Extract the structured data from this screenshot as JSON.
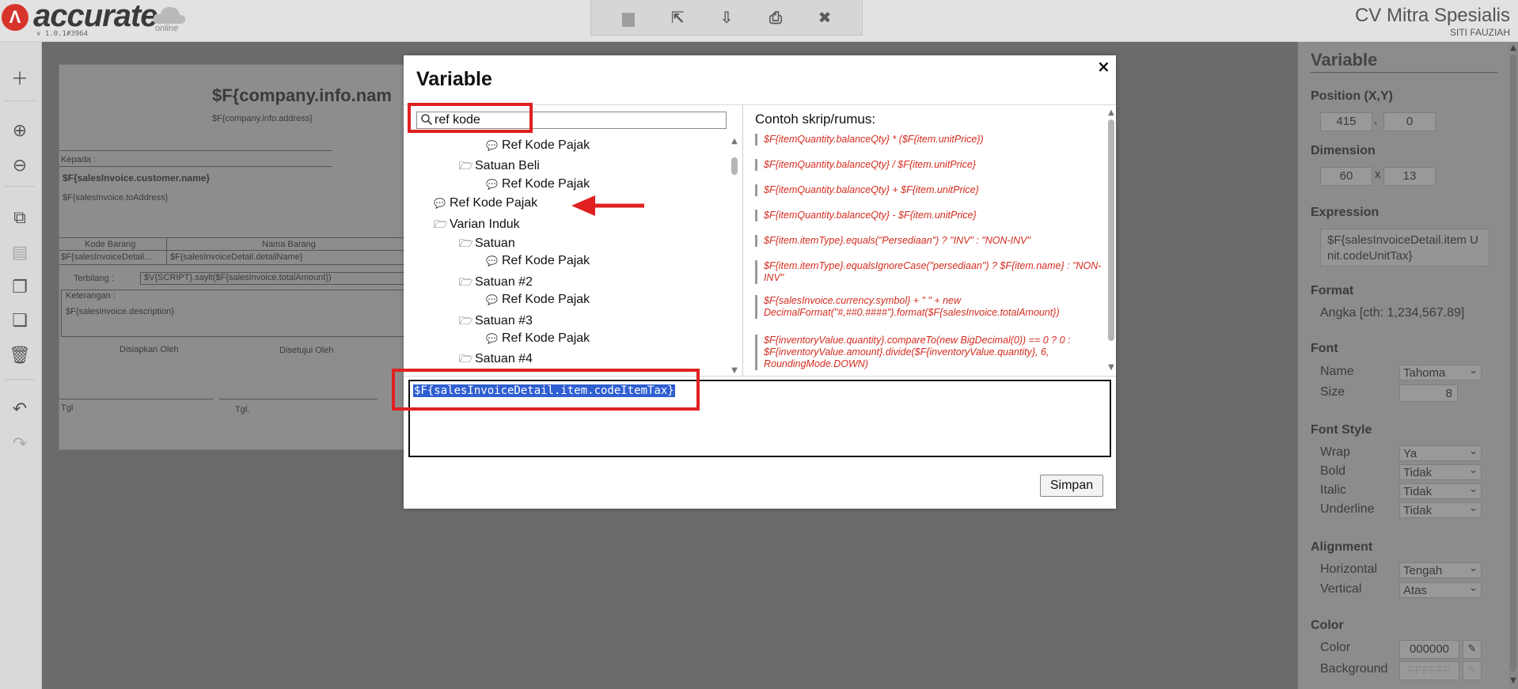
{
  "app": {
    "logo_text": "accurate",
    "version": "v 1.0.1#3964",
    "logo_sub": "online",
    "company": "CV Mitra Spesialis",
    "user": "SITI FAUZIAH"
  },
  "document": {
    "company_name": "$F{company.info.nam",
    "company_address": "$F{company.info.address}",
    "kepada_label": "Kepada :",
    "customer_name": "$F{salesInvoice.customer.name}",
    "to_address": "$F{salesInvoice.toAddress}",
    "col_kode": "Kode Barang",
    "col_nama": "Nama Barang",
    "cell_kode": "$F{salesInvoiceDetail...",
    "cell_nama": "$F{salesInvoiceDetail.detailName}",
    "terbilang_label": "Terbilang :",
    "terbilang_value": "$V{SCRIPT}.saylt($F{salesInvoice.totalAmount})",
    "keterangan_label": "Keterangan :",
    "keterangan_value": "$F{salesInvoice.description}",
    "disiapkan": "Disiapkan Oleh",
    "disetujui": "Disetujui Oleh",
    "tgl1": "Tgl",
    "tgl2": "Tgl."
  },
  "modal": {
    "title": "Variable",
    "close": "×",
    "search_value": "ref kode",
    "tree": [
      {
        "label": "Ref Kode Pajak",
        "icon": "comment-icon",
        "level": 2
      },
      {
        "label": "Satuan Beli",
        "icon": "folder-open-icon",
        "level": 1
      },
      {
        "label": "Ref Kode Pajak",
        "icon": "comment-icon",
        "level": 2
      },
      {
        "label": "Ref Kode Pajak",
        "icon": "comment-icon",
        "level": 0
      },
      {
        "label": "Varian Induk",
        "icon": "folder-open-icon",
        "level": 0
      },
      {
        "label": "Satuan",
        "icon": "folder-open-icon",
        "level": 1
      },
      {
        "label": "Ref Kode Pajak",
        "icon": "comment-icon",
        "level": 2
      },
      {
        "label": "Satuan #2",
        "icon": "folder-open-icon",
        "level": 1
      },
      {
        "label": "Ref Kode Pajak",
        "icon": "comment-icon",
        "level": 2
      },
      {
        "label": "Satuan #3",
        "icon": "folder-open-icon",
        "level": 1
      },
      {
        "label": "Ref Kode Pajak",
        "icon": "comment-icon",
        "level": 2
      },
      {
        "label": "Satuan #4",
        "icon": "folder-open-icon",
        "level": 1
      }
    ],
    "examples_title": "Contoh skrip/rumus:",
    "examples": [
      "$F{itemQuantity.balanceQty} * ($F{item.unitPrice})",
      "$F{itemQuantity.balanceQty} / $F{item.unitPrice}",
      "$F{itemQuantity.balanceQty} + $F{item.unitPrice}",
      "$F{itemQuantity.balanceQty} - $F{item.unitPrice}",
      "$F{item.itemType}.equals(\"Persediaan\") ? \"INV\" : \"NON-INV\"",
      "$F{item.itemType}.equalsIgnoreCase(\"persediaan\") ? $F{item.name} : \"NON-INV\"",
      "$F{salesInvoice.currency.symbol} + \" \" + new DecimalFormat(\"#,##0.####\").format($F{salesInvoice.totalAmount})",
      "$F{inventoryValue.quantity}.compareTo(new BigDecimal(0)) == 0 ? 0 : $F{inventoryValue.amount}.divide($F{inventoryValue.quantity}, 6, RoundingMode.DOWN)"
    ],
    "expression": "$F{salesInvoiceDetail.item.codeItemTax}",
    "save_label": "Simpan"
  },
  "panel": {
    "title": "Variable",
    "position_label": "Position (X,Y)",
    "pos_x": "415",
    "pos_sep": ",",
    "pos_y": "0",
    "dimension_label": "Dimension",
    "dim_w": "60",
    "dim_sep": "x",
    "dim_h": "13",
    "expression_label": "Expression",
    "expression_value": "$F{salesInvoiceDetail.item Unit.codeUnitTax}",
    "format_label": "Format",
    "format_value": "Angka [cth: 1,234,567.89]",
    "font_label": "Font",
    "font_name_label": "Name",
    "font_name_value": "Tahoma",
    "font_size_label": "Size",
    "font_size_value": "8",
    "font_style_label": "Font Style",
    "wrap_label": "Wrap",
    "wrap_value": "Ya",
    "bold_label": "Bold",
    "bold_value": "Tidak",
    "italic_label": "Italic",
    "italic_value": "Tidak",
    "underline_label": "Underline",
    "underline_value": "Tidak",
    "alignment_label": "Alignment",
    "horizontal_label": "Horizontal",
    "horizontal_value": "Tengah",
    "vertical_label": "Vertical",
    "vertical_value": "Atas",
    "color_label": "Color",
    "color_field_label": "Color",
    "color_value": "000000",
    "background_label": "Background",
    "background_value": "FFFFFF"
  }
}
